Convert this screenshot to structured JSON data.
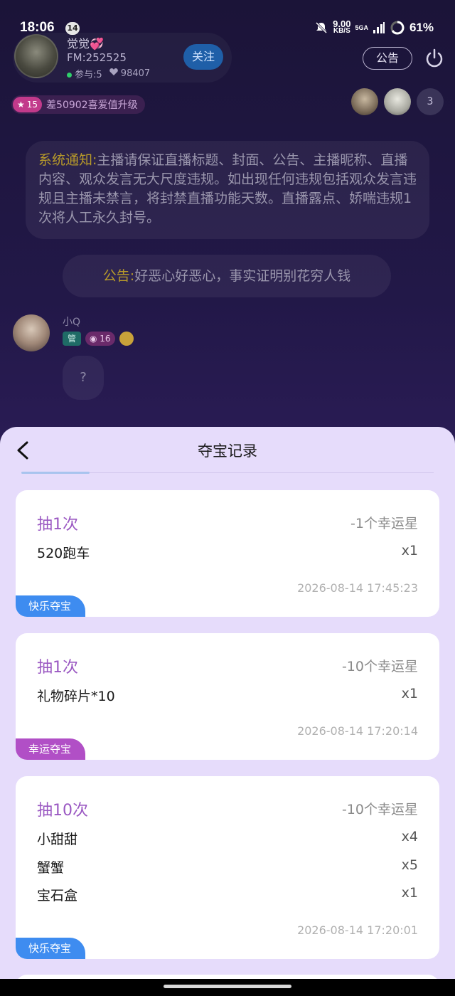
{
  "status_bar": {
    "time": "18:06",
    "notification_count": "14",
    "speed_value": "9.00",
    "speed_unit": "KB/S",
    "network": "5GA",
    "battery": "61%"
  },
  "host": {
    "name": "觉觉💞",
    "fm": "FM:252525",
    "participants": "参与:5",
    "likes": "98407",
    "follow_label": "关注"
  },
  "header_actions": {
    "notice_label": "公告"
  },
  "level_bar": {
    "level": "15",
    "text": "差50902喜爱值升级"
  },
  "viewers": {
    "count": "3"
  },
  "chat": {
    "system_label": "系统通知:",
    "system_text": "主播请保证直播标题、封面、公告、主播昵称、直播内容、观众发言无大尺度违规。如出现任何违规包括观众发言违规且主播未禁言，将封禁直播功能天数。直播露点、娇喘违规1次将人工永久封号。",
    "announcement_label": "公告:",
    "announcement_text": "好恶心好恶心，事实证明别花穷人钱",
    "messages": [
      {
        "name": "小Q",
        "role_badge": "管",
        "level": "16",
        "text": "?"
      }
    ]
  },
  "sheet": {
    "title": "夺宝记录",
    "records": [
      {
        "draw": "抽1次",
        "cost": "-1个幸运星",
        "items": [
          {
            "name": "520跑车",
            "qty": "x1"
          }
        ],
        "time": "2026-08-14 17:45:23",
        "tag": "快乐夺宝"
      },
      {
        "draw": "抽1次",
        "cost": "-10个幸运星",
        "items": [
          {
            "name": "礼物碎片*10",
            "qty": "x1"
          }
        ],
        "time": "2026-08-14 17:20:14",
        "tag": "幸运夺宝"
      },
      {
        "draw": "抽10次",
        "cost": "-10个幸运星",
        "items": [
          {
            "name": "小甜甜",
            "qty": "x4"
          },
          {
            "name": "蟹蟹",
            "qty": "x5"
          },
          {
            "name": "宝石盒",
            "qty": "x1"
          }
        ],
        "time": "2026-08-14 17:20:01",
        "tag": "快乐夺宝"
      }
    ]
  },
  "colors": {
    "sheet_bg": "#e6dcfb",
    "draw_text": "#9a58c2",
    "tag_happy": "#3e8cf0",
    "tag_lucky": "#b14fc6",
    "system_label": "#b89a2a"
  }
}
